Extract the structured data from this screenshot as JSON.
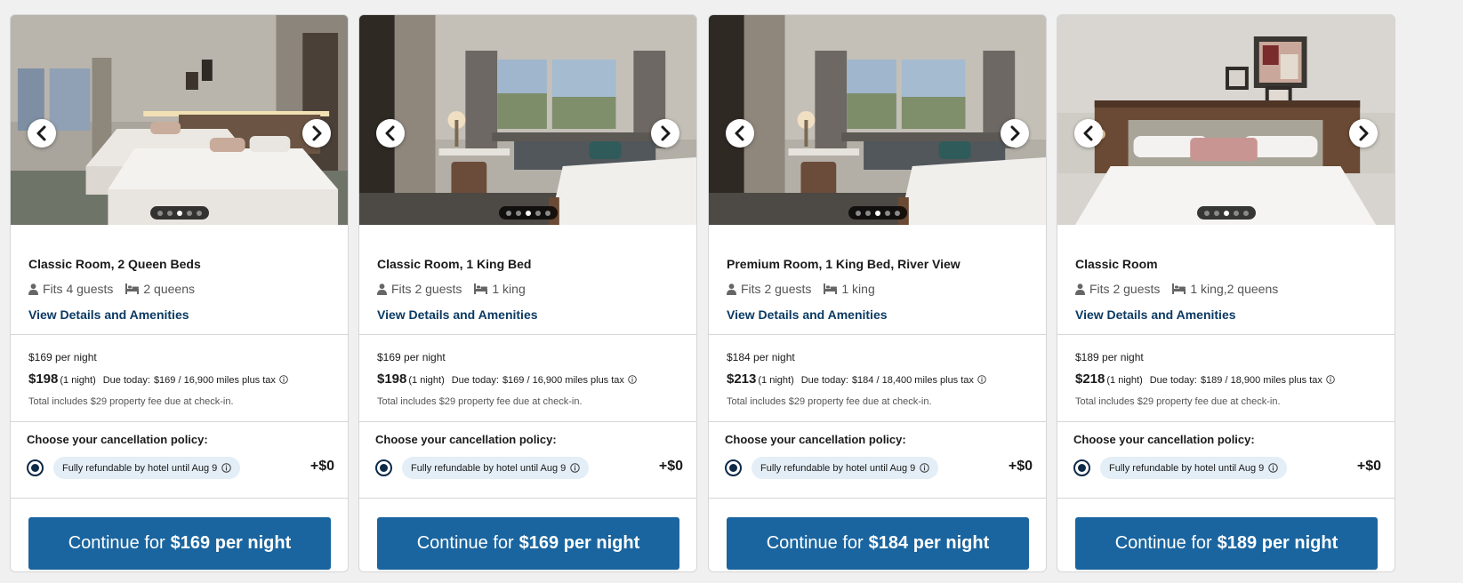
{
  "cards": [
    {
      "title": "Classic Room, 2 Queen Beds",
      "guests": "Fits 4 guests",
      "beds": "2 queens",
      "details_link": "View Details and Amenities",
      "per_night": "$169 per night",
      "total": "$198",
      "nights": "(1 night)",
      "due_label": "Due today:",
      "due_value": "$169 / 16,900 miles plus tax",
      "fee_note": "Total includes $29 property fee due at check-in.",
      "cancel_title": "Choose your cancellation policy:",
      "policy": "Fully refundable by hotel until Aug 9",
      "extra": "+$0",
      "cta_prefix": "Continue for",
      "cta_price": "$169 per night",
      "active_dot": 2,
      "dot_count": 5,
      "photo_style": "queens"
    },
    {
      "title": "Classic Room, 1 King Bed",
      "guests": "Fits 2 guests",
      "beds": "1 king",
      "details_link": "View Details and Amenities",
      "per_night": "$169 per night",
      "total": "$198",
      "nights": "(1 night)",
      "due_label": "Due today:",
      "due_value": "$169 / 16,900 miles plus tax",
      "fee_note": "Total includes $29 property fee due at check-in.",
      "cancel_title": "Choose your cancellation policy:",
      "policy": "Fully refundable by hotel until Aug 9",
      "extra": "+$0",
      "cta_prefix": "Continue for",
      "cta_price": "$169 per night",
      "active_dot": 2,
      "dot_count": 5,
      "photo_style": "king-window"
    },
    {
      "title": "Premium Room, 1 King Bed, River View",
      "guests": "Fits 2 guests",
      "beds": "1 king",
      "details_link": "View Details and Amenities",
      "per_night": "$184 per night",
      "total": "$213",
      "nights": "(1 night)",
      "due_label": "Due today:",
      "due_value": "$184 / 18,400 miles plus tax",
      "fee_note": "Total includes $29 property fee due at check-in.",
      "cancel_title": "Choose your cancellation policy:",
      "policy": "Fully refundable by hotel until Aug 9",
      "extra": "+$0",
      "cta_prefix": "Continue for",
      "cta_price": "$184 per night",
      "active_dot": 2,
      "dot_count": 5,
      "photo_style": "king-window"
    },
    {
      "title": "Classic Room",
      "guests": "Fits 2 guests",
      "beds": "1 king,2 queens",
      "details_link": "View Details and Amenities",
      "per_night": "$189 per night",
      "total": "$218",
      "nights": "(1 night)",
      "due_label": "Due today:",
      "due_value": "$189 / 18,900 miles plus tax",
      "fee_note": "Total includes $29 property fee due at check-in.",
      "cancel_title": "Choose your cancellation policy:",
      "policy": "Fully refundable by hotel until Aug 9",
      "extra": "+$0",
      "cta_prefix": "Continue for",
      "cta_price": "$189 per night",
      "active_dot": 2,
      "dot_count": 5,
      "photo_style": "headboard"
    }
  ],
  "icons": {
    "guests": "person-icon",
    "beds": "bed-icon",
    "info": "info-icon",
    "prev": "chevron-left-icon",
    "next": "chevron-right-icon"
  },
  "colors": {
    "cta": "#1a659f",
    "link": "#0b3a63",
    "pill": "#e3eef7",
    "radio": "#0e2a47"
  }
}
